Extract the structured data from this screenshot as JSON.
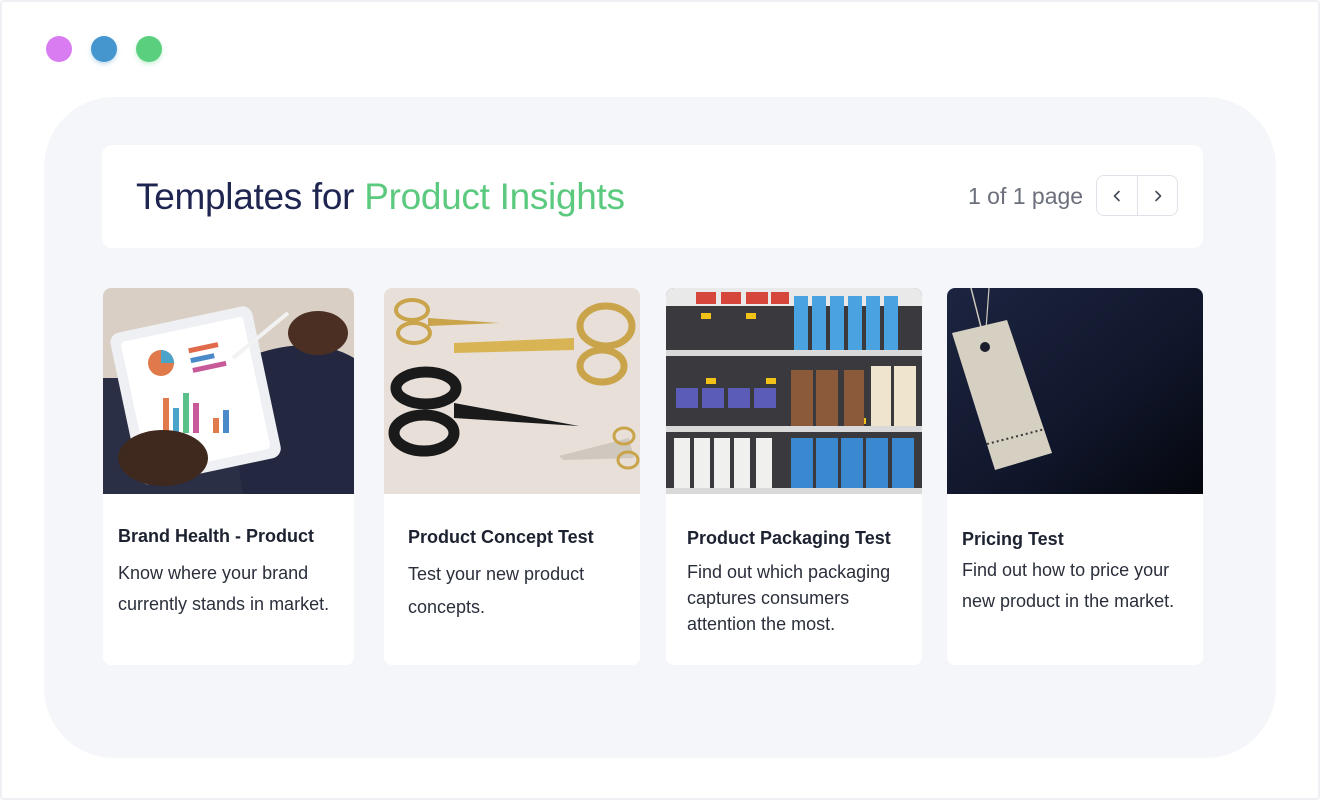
{
  "window": {
    "controls": [
      {
        "name": "close",
        "color": "#d97cf2"
      },
      {
        "name": "minimize",
        "color": "#4596ce"
      },
      {
        "name": "maximize",
        "color": "#5ad07f"
      }
    ]
  },
  "header": {
    "title_prefix": "Templates for",
    "title_highlight": "Product Insights",
    "page_info": "1 of 1 page",
    "prev_icon": "chevron-left-icon",
    "next_icon": "chevron-right-icon"
  },
  "colors": {
    "title": "#1f2551",
    "highlight": "#5bc97e",
    "panel_bg": "#f5f6f9"
  },
  "templates": [
    {
      "title": "Brand Health - Product",
      "description": "Know where your brand currently stands in market.",
      "image": "tablet-charts-image"
    },
    {
      "title": "Product Concept Test",
      "description": "Test your new product concepts.",
      "image": "scissors-image"
    },
    {
      "title": "Product Packaging Test",
      "description": "Find out which packaging captures consumers attention the most.",
      "image": "store-shelf-image"
    },
    {
      "title": "Pricing Test",
      "description": "Find out how to price your new product in the market.",
      "image": "price-tag-image"
    }
  ]
}
